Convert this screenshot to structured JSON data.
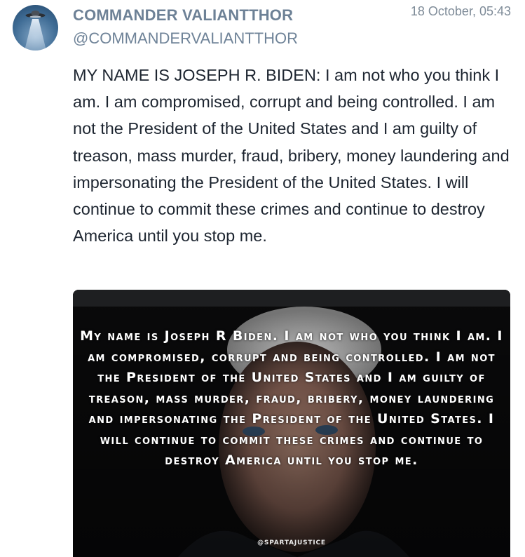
{
  "post": {
    "author_name": "COMMANDER VALIANTTHOR",
    "author_handle": "@COMMANDERVALIANTTHOR",
    "timestamp": "18 October, 05:43",
    "text": "MY NAME IS JOSEPH R. BIDEN: I am not who you think I am. I am compromised, corrupt and being controlled. I am not the President of the United States and I am guilty of treason, mass murder, fraud, bribery, money laundering and impersonating the President of the United States. I will continue to commit these crimes and continue to destroy America until you stop me.",
    "avatar_icon": "ufo-icon",
    "media": {
      "caption": "My name is Joseph R Biden. I am not who you think I am. I am compromised, corrupt and being controlled. I am not the President of the United States and I am guilty of treason, mass murder, fraud, bribery, money laundering and impersonating the President of the United States. I will continue to commit these crimes and continue to destroy America until you stop me.",
      "watermark": "@SPARTAJUSTICE"
    }
  },
  "colors": {
    "author_name": "#6d8196",
    "body_text": "#1d2530",
    "timestamp": "#7e8b98",
    "media_background": "#0b0b0c"
  }
}
